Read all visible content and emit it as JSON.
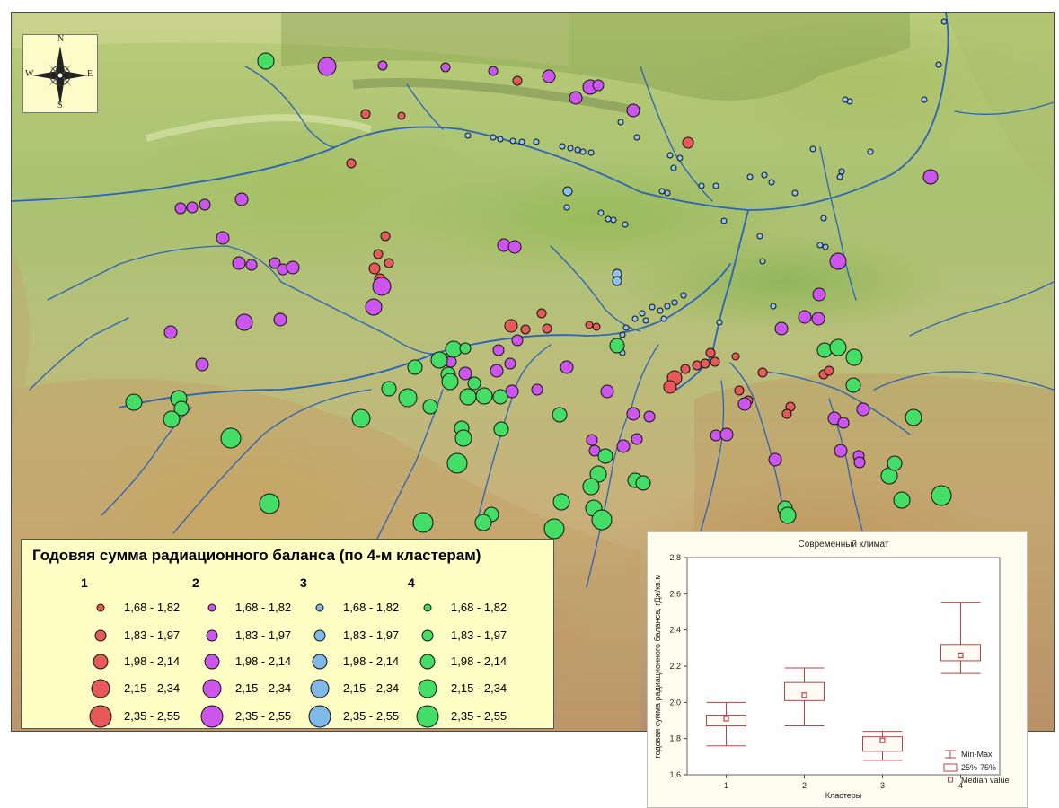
{
  "compass": {
    "n": "N",
    "s": "S",
    "e": "E",
    "w": "W"
  },
  "legend": {
    "title": "Годовяя сумма радиационного баланса (по 4-м кластерам)",
    "clusters": [
      {
        "label": "1",
        "color": "#e85a5a"
      },
      {
        "label": "2",
        "color": "#cc55ee"
      },
      {
        "label": "3",
        "color": "#80b8e8"
      },
      {
        "label": "4",
        "color": "#44dd66"
      }
    ],
    "classes": [
      "1,68 - 1,82",
      "1,83 - 1,97",
      "1,98 - 2,14",
      "2,15 - 2,34",
      "2,35 - 2,55"
    ]
  },
  "chart_data": {
    "type": "boxplot",
    "title": "Современный климат",
    "xlabel": "Кластеры",
    "ylabel": "годовая сумма радиационного баланса, гДж/кв.м",
    "categories": [
      "1",
      "2",
      "3",
      "4"
    ],
    "ylim": [
      1.6,
      2.8
    ],
    "yticks": [
      "1,6",
      "1,8",
      "2,0",
      "2,2",
      "2,4",
      "2,6",
      "2,8"
    ],
    "ytick_values": [
      1.6,
      1.8,
      2.0,
      2.2,
      2.4,
      2.6,
      2.8
    ],
    "series": [
      {
        "min": 1.76,
        "q1": 1.87,
        "median": 1.91,
        "q3": 1.93,
        "max": 2.0
      },
      {
        "min": 1.87,
        "q1": 2.01,
        "median": 2.04,
        "q3": 2.11,
        "max": 2.19
      },
      {
        "min": 1.68,
        "q1": 1.73,
        "median": 1.79,
        "q3": 1.81,
        "max": 1.84
      },
      {
        "min": 2.16,
        "q1": 2.23,
        "median": 2.26,
        "q3": 2.32,
        "max": 2.55
      }
    ],
    "legend": [
      "Min-Max",
      "25%-75%",
      "Median value"
    ],
    "color": "#c04040"
  }
}
